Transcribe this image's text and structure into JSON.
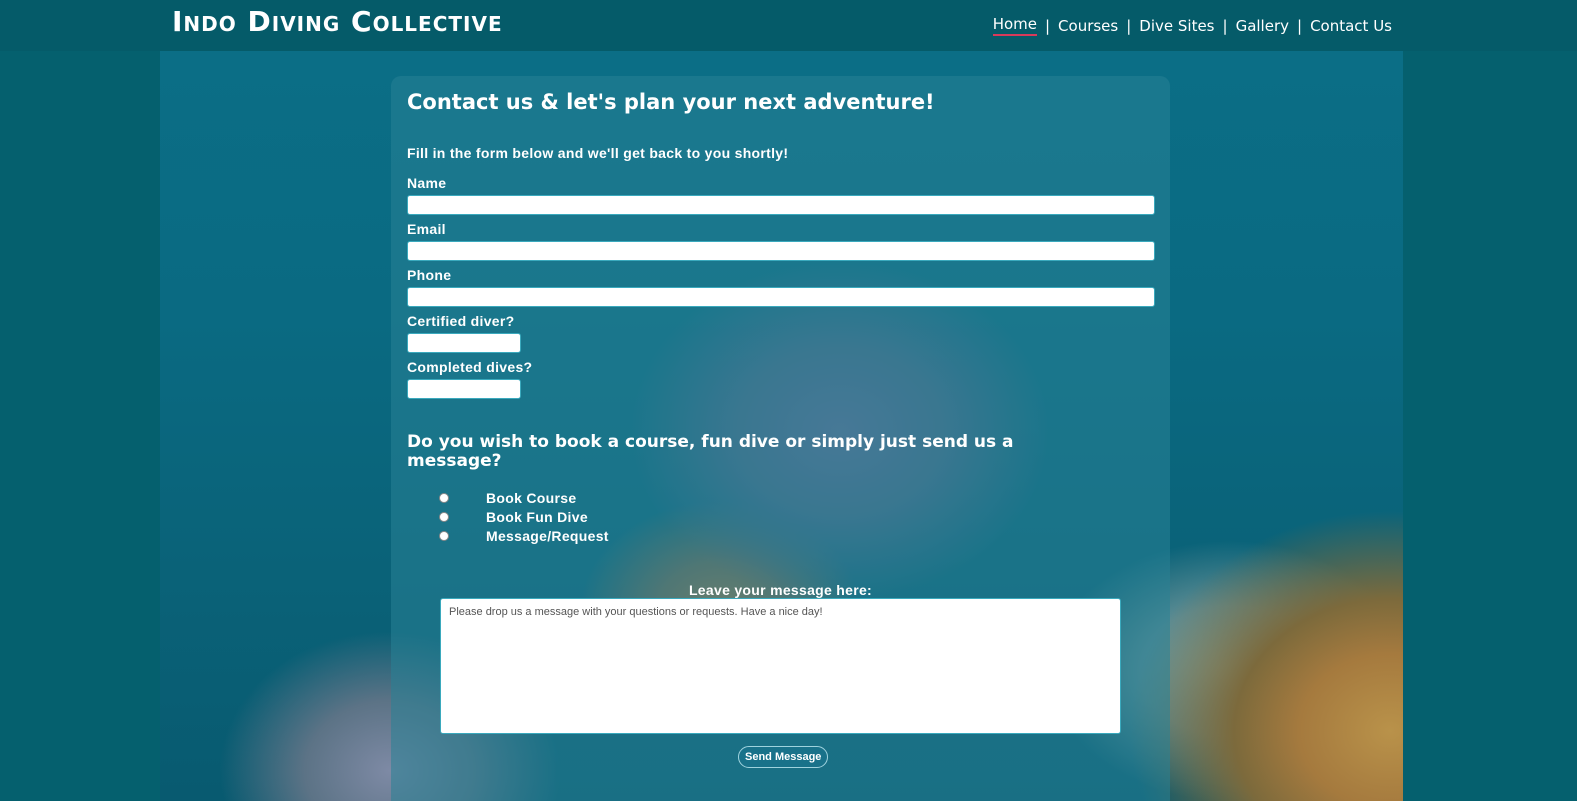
{
  "header": {
    "site_title": "Indo Diving Collective",
    "nav": [
      {
        "label": "Home",
        "active": true
      },
      {
        "label": "Courses",
        "active": false
      },
      {
        "label": "Dive Sites",
        "active": false
      },
      {
        "label": "Gallery",
        "active": false
      },
      {
        "label": "Contact Us",
        "active": false
      }
    ],
    "separator": "|"
  },
  "form": {
    "title": "Contact us & let's plan your next adventure!",
    "intro": "Fill in the form below and we'll get back to you shortly!",
    "fields": {
      "name": {
        "label": "Name",
        "value": ""
      },
      "email": {
        "label": "Email",
        "value": ""
      },
      "phone": {
        "label": "Phone",
        "value": ""
      },
      "certified": {
        "label": "Certified diver?",
        "value": ""
      },
      "dives": {
        "label": "Completed dives?",
        "value": ""
      }
    },
    "question": "Do you wish to book a course, fun dive or simply just send us a message?",
    "options": [
      {
        "label": "Book Course",
        "checked": false
      },
      {
        "label": "Book Fun Dive",
        "checked": false
      },
      {
        "label": "Message/Request",
        "checked": false
      }
    ],
    "message_label": "Leave your message here:",
    "message_placeholder": "Please drop us a message with your questions or requests. Have a nice day!",
    "submit_label": "Send Message"
  },
  "colors": {
    "header_bg": "#055b69",
    "active_underline": "#d83a5a",
    "button_bg": "#19728a"
  }
}
